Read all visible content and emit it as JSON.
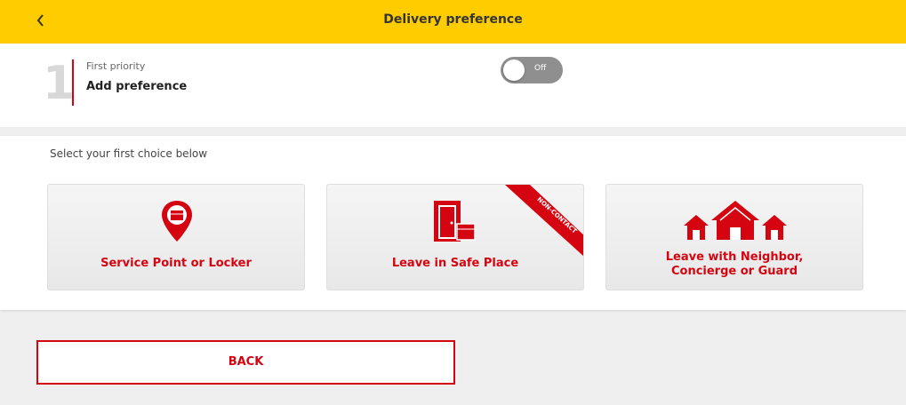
{
  "header": {
    "title": "Delivery preference",
    "back_icon": "chevron-left-icon",
    "background_color": "#ffcc00"
  },
  "priority": {
    "number": "1",
    "caption": "First priority",
    "value": "Add preference",
    "toggle_label": "Off",
    "toggle_on": false
  },
  "choices": {
    "instruction": "Select your first choice below",
    "options": [
      {
        "label": "Service Point or Locker",
        "icon": "location-pin-parcel-icon"
      },
      {
        "label": "Leave in Safe Place",
        "icon": "door-parcel-icon",
        "ribbon": "NON-CONTACT"
      },
      {
        "label_line1": "Leave with Neighbor,",
        "label_line2": "Concierge or Guard",
        "icon": "houses-icon"
      }
    ]
  },
  "footer": {
    "back_label": "BACK"
  },
  "colors": {
    "accent": "#d40511",
    "brand_yellow": "#ffcc00"
  }
}
